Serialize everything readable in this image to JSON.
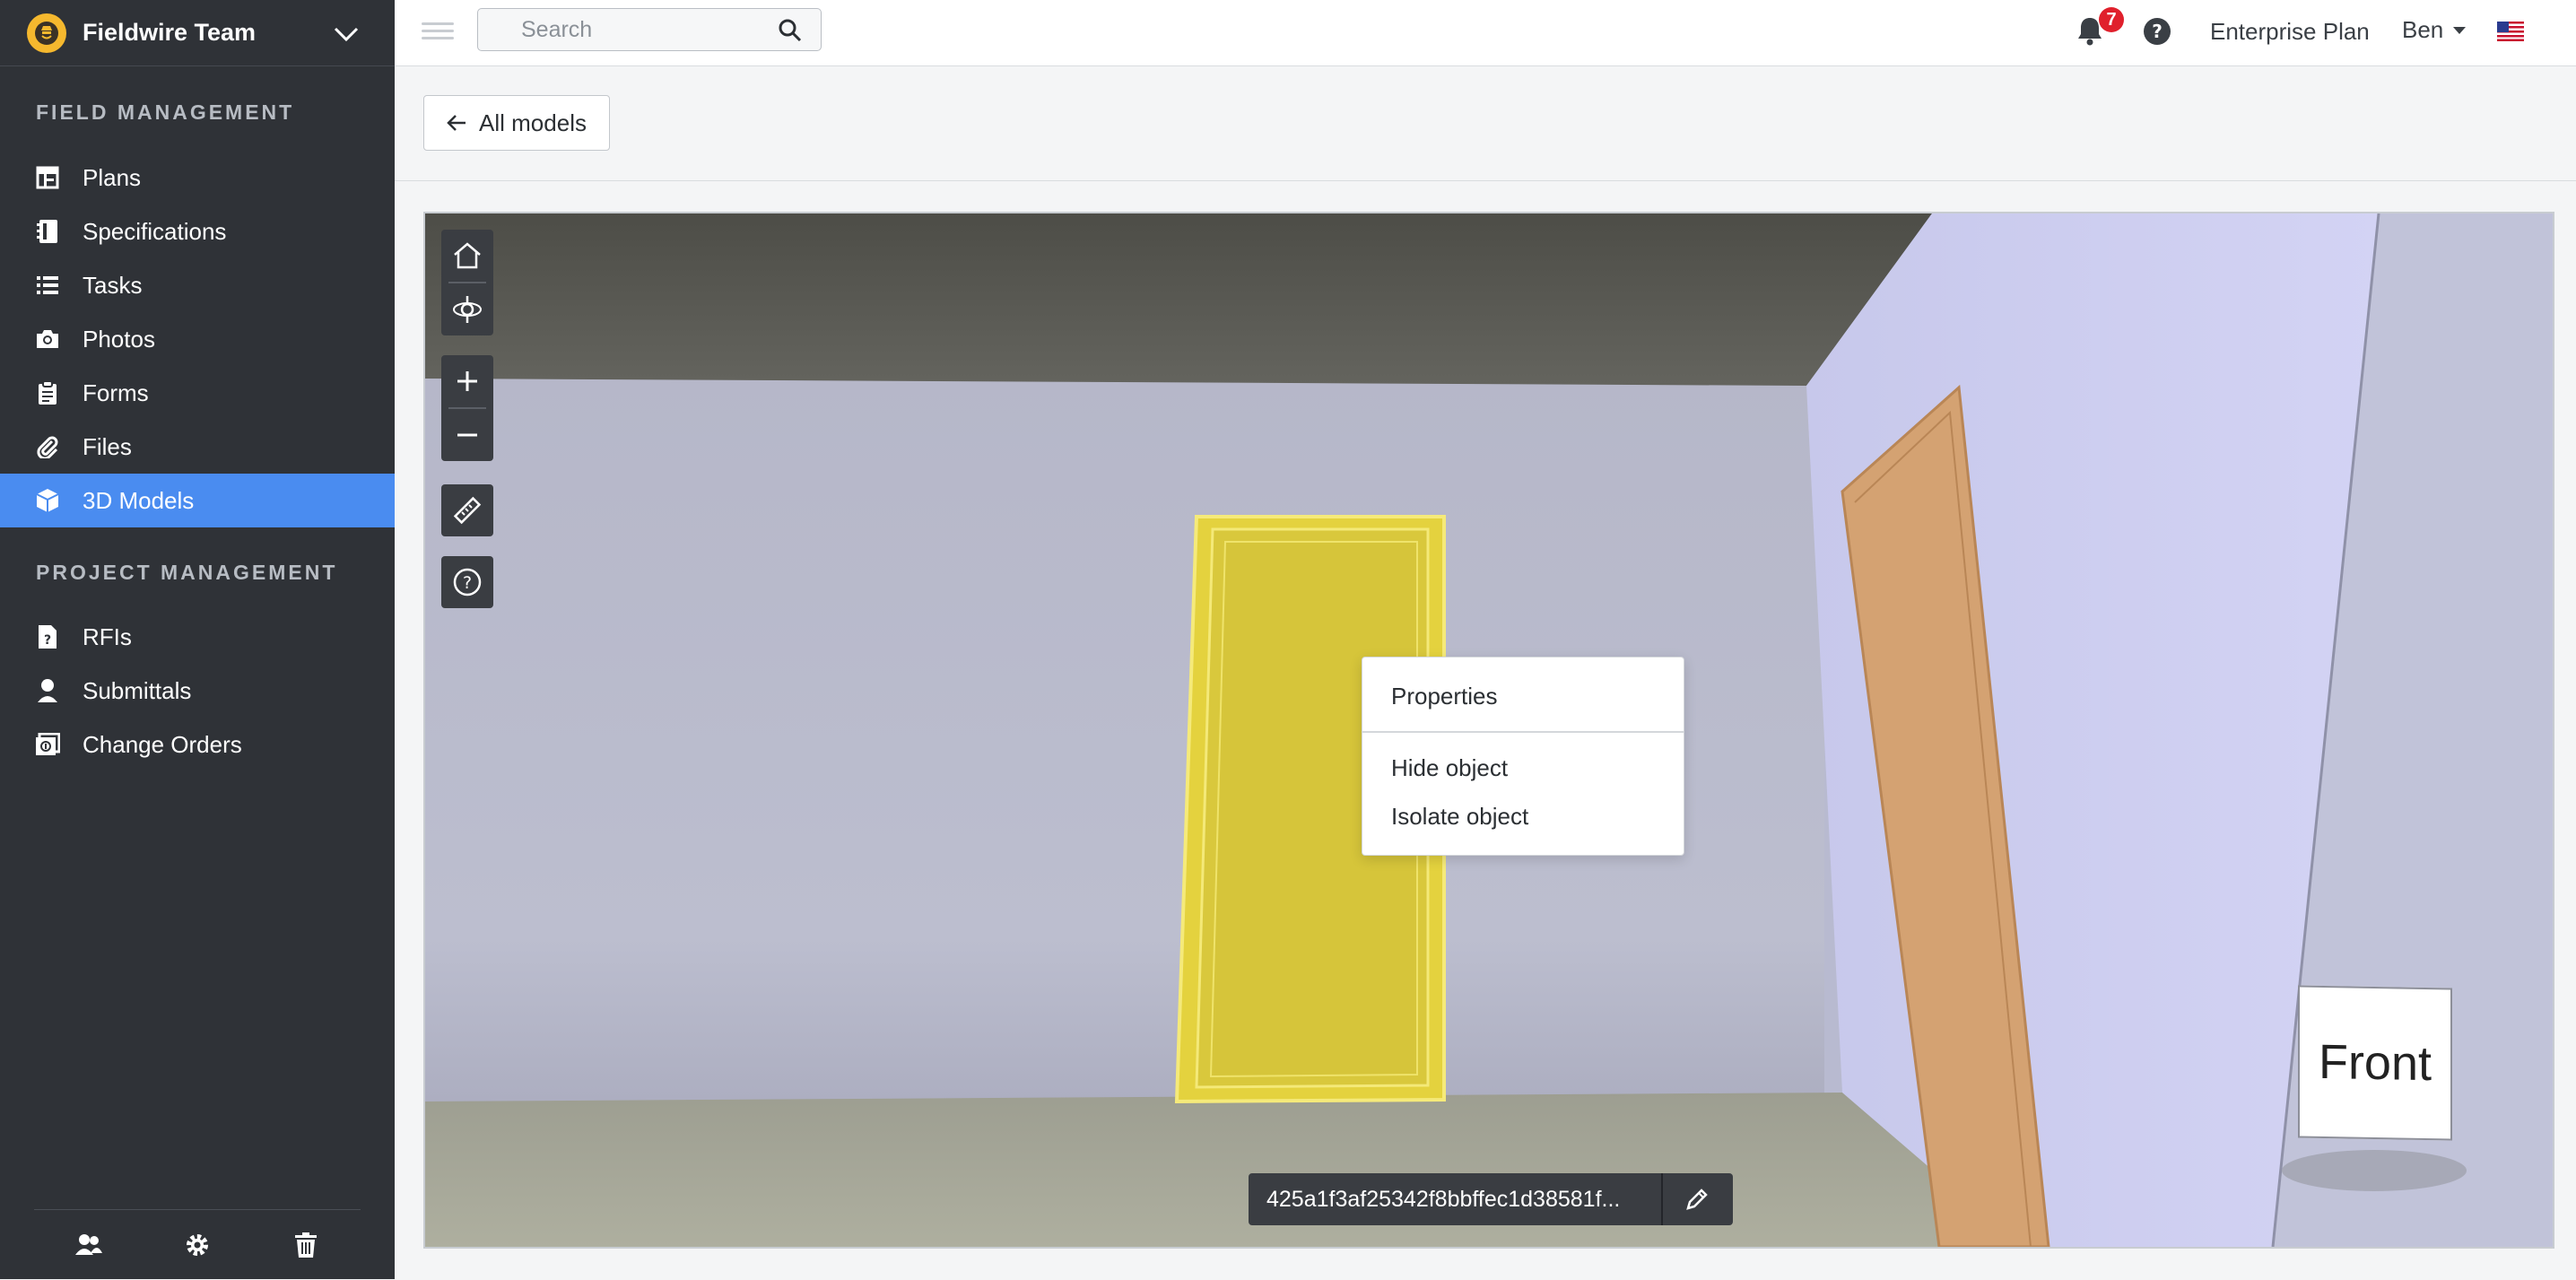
{
  "sidebar": {
    "team_name": "Fieldwire Team",
    "sections": {
      "field_title": "FIELD MANAGEMENT",
      "project_title": "PROJECT MANAGEMENT"
    },
    "field_items": [
      {
        "label": "Plans",
        "icon": "plans-icon"
      },
      {
        "label": "Specifications",
        "icon": "specifications-icon"
      },
      {
        "label": "Tasks",
        "icon": "tasks-icon"
      },
      {
        "label": "Photos",
        "icon": "camera-icon"
      },
      {
        "label": "Forms",
        "icon": "clipboard-icon"
      },
      {
        "label": "Files",
        "icon": "paperclip-icon"
      },
      {
        "label": "3D Models",
        "icon": "cube-icon",
        "active": true
      }
    ],
    "project_items": [
      {
        "label": "RFIs",
        "icon": "rfi-icon"
      },
      {
        "label": "Submittals",
        "icon": "person-icon"
      },
      {
        "label": "Change Orders",
        "icon": "change-orders-icon"
      }
    ],
    "footer_icons": [
      "users-icon",
      "gear-icon",
      "trash-icon"
    ]
  },
  "topbar": {
    "search_placeholder": "Search",
    "notification_count": "7",
    "plan_label": "Enterprise Plan",
    "user_name": "Ben"
  },
  "subheader": {
    "back_label": "All models"
  },
  "viewer": {
    "toolbar_icons": [
      "home-icon",
      "orbit-icon",
      "zoom-in-icon",
      "zoom-out-icon",
      "ruler-icon",
      "help-circle-icon"
    ],
    "context_menu": {
      "properties": "Properties",
      "hide": "Hide object",
      "isolate": "Isolate object"
    },
    "view_cube_label": "Front",
    "model_id": "425a1f3af25342f8bbffec1d38581f..."
  },
  "colors": {
    "sidebar_bg": "#2f3237",
    "active_item": "#4a8cf0",
    "selected_door": "#e4d23e",
    "notification_badge": "#e0202c"
  }
}
